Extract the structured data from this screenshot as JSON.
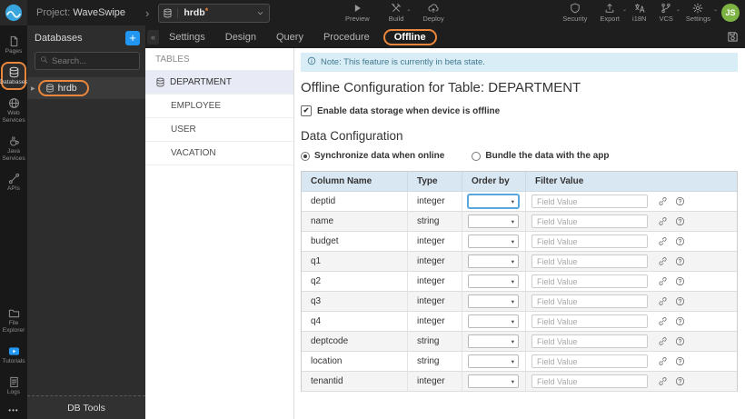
{
  "colors": {
    "accent-orange": "#EA873C",
    "accent-blue": "#2196F3",
    "note-bg": "#D9EDF7",
    "note-text": "#41788F",
    "selected-row-bg": "#E8EAF6",
    "table-header-bg": "#D9E7F3",
    "avatar-green": "#7CB342",
    "logo-blue": "#38A5DE",
    "focus-blue": "#58A6DC"
  },
  "glyphs": {
    "breadcrumb_chevron": "›",
    "caret_down": "⌄",
    "select_caret": "▾",
    "collapse": "«",
    "tree_expand": "▶",
    "plus": "+",
    "more": "•••",
    "check": "✔"
  },
  "topbar": {
    "project_label": "Project:",
    "project_name": "WaveSwipe",
    "db_selector": {
      "icon": "database-icon",
      "value": "hrdb",
      "dirty_marker": "*"
    },
    "center_actions": [
      {
        "id": "preview",
        "label": "Preview",
        "icon": "play-icon",
        "has_caret": false
      },
      {
        "id": "build",
        "label": "Build",
        "icon": "build-icon",
        "has_caret": true
      },
      {
        "id": "deploy",
        "label": "Deploy",
        "icon": "deploy-icon",
        "has_caret": false
      }
    ],
    "right_actions": [
      {
        "id": "security",
        "label": "Security",
        "icon": "shield-icon",
        "has_caret": false
      },
      {
        "id": "export",
        "label": "Export",
        "icon": "export-icon",
        "has_caret": true
      },
      {
        "id": "i18n",
        "label": "i18N",
        "icon": "i18n-icon",
        "has_caret": false
      },
      {
        "id": "vcs",
        "label": "VCS",
        "icon": "vcs-icon",
        "has_caret": true
      },
      {
        "id": "settings",
        "label": "Settings",
        "icon": "gear-icon",
        "has_caret": true
      }
    ],
    "avatar_initials": "JS"
  },
  "sidebar": {
    "top_items": [
      {
        "id": "pages",
        "label": "Pages",
        "icon": "page-icon",
        "active": false
      },
      {
        "id": "databases",
        "label": "Databases",
        "icon": "database-icon",
        "active": true
      },
      {
        "id": "web-services",
        "label": "Web Services",
        "icon": "globe-icon",
        "active": false
      },
      {
        "id": "java-services",
        "label": "Java Services",
        "icon": "java-icon",
        "active": false
      },
      {
        "id": "apis",
        "label": "APIs",
        "icon": "api-icon",
        "active": false
      }
    ],
    "bottom_items": [
      {
        "id": "file-explorer",
        "label": "File Explorer",
        "icon": "folder-icon",
        "active": false
      },
      {
        "id": "tutorials",
        "label": "Tutorials",
        "icon": "tutorials-icon",
        "active": false
      },
      {
        "id": "logs",
        "label": "Logs",
        "icon": "logs-icon",
        "active": false
      }
    ]
  },
  "db_panel": {
    "title": "Databases",
    "search_placeholder": "Search...",
    "tree": [
      {
        "label": "hrdb",
        "icon": "database-icon",
        "selected": true,
        "highlighted": true
      }
    ],
    "footer_label": "DB Tools"
  },
  "tabbar": {
    "tabs": [
      {
        "label": "Settings",
        "active": false
      },
      {
        "label": "Design",
        "active": false
      },
      {
        "label": "Query",
        "active": false
      },
      {
        "label": "Procedure",
        "active": false
      },
      {
        "label": "Offline",
        "active": true
      }
    ]
  },
  "tables_panel": {
    "title": "TABLES",
    "items": [
      {
        "label": "DEPARTMENT",
        "selected": true
      },
      {
        "label": "EMPLOYEE",
        "selected": false
      },
      {
        "label": "USER",
        "selected": false
      },
      {
        "label": "VACATION",
        "selected": false
      }
    ]
  },
  "content": {
    "note_text": "Note: This feature is currently in beta state.",
    "page_title": "Offline Configuration for Table: DEPARTMENT",
    "enable_offline_label": "Enable data storage when device is offline",
    "enable_offline_checked": true,
    "section_title": "Data Configuration",
    "sync_options": [
      {
        "label": "Synchronize data when online",
        "selected": true
      },
      {
        "label": "Bundle the data with the app",
        "selected": false
      }
    ],
    "columns_table": {
      "headers": [
        "Column Name",
        "Type",
        "Order by",
        "Filter Value"
      ],
      "filter_placeholder": "Field Value",
      "order_by_value": "",
      "rows": [
        {
          "column_name": "deptid",
          "type": "integer",
          "focused": true
        },
        {
          "column_name": "name",
          "type": "string",
          "focused": false
        },
        {
          "column_name": "budget",
          "type": "integer",
          "focused": false
        },
        {
          "column_name": "q1",
          "type": "integer",
          "focused": false
        },
        {
          "column_name": "q2",
          "type": "integer",
          "focused": false
        },
        {
          "column_name": "q3",
          "type": "integer",
          "focused": false
        },
        {
          "column_name": "q4",
          "type": "integer",
          "focused": false
        },
        {
          "column_name": "deptcode",
          "type": "string",
          "focused": false
        },
        {
          "column_name": "location",
          "type": "string",
          "focused": false
        },
        {
          "column_name": "tenantid",
          "type": "integer",
          "focused": false
        }
      ]
    }
  }
}
